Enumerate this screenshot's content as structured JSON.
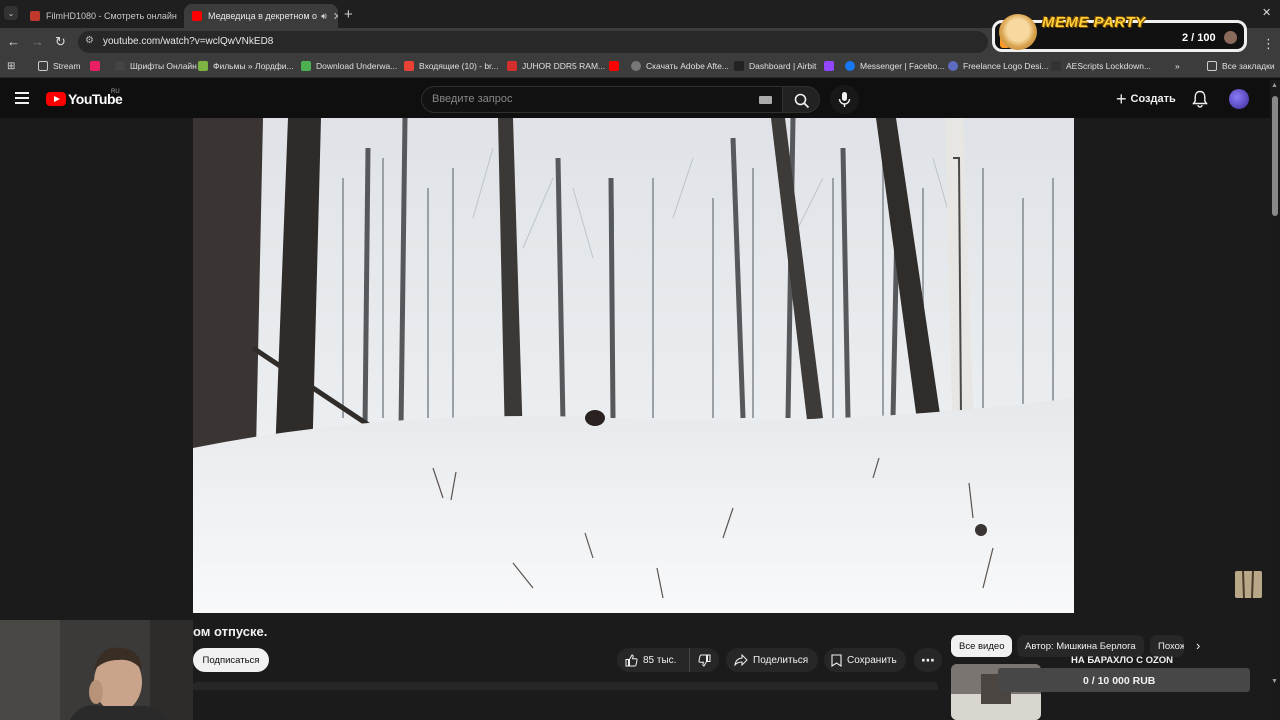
{
  "browser": {
    "tabs": [
      {
        "title": "FilmHD1080 - Смотреть онлайн",
        "active": false
      },
      {
        "title": "Медведица в декретном о",
        "active": true
      }
    ],
    "url": "youtube.com/watch?v=wclQwVNkED8",
    "bookmarks": [
      "Stream",
      "Шрифты Онлайн",
      "Фильмы » Лордфи...",
      "Download Underwa...",
      "Входящие (10) - br...",
      "JUHOR DDR5 RAM...",
      "Скачать Adobe Afte...",
      "Dashboard | Airbit",
      "Messenger | Facebo...",
      "Freelance Logo Desi...",
      "AEScripts Lockdown...",
      "Все закладки"
    ]
  },
  "meme_party": {
    "title": "MEME PARTY",
    "count": "2 / 100"
  },
  "youtube": {
    "logo_text": "YouTube",
    "region": "RU",
    "search_placeholder": "Введите запрос",
    "create_label": "Создать",
    "video_title": "ом отпуске.",
    "subscribe_label": "Подписаться",
    "likes": "85 тыс.",
    "share_label": "Поделиться",
    "save_label": "Сохранить",
    "chips": [
      "Все видео",
      "Автор: Мишкина Берлога",
      "Похож"
    ]
  },
  "donation": {
    "title": "НА БАРАХЛО С OZON",
    "amount": "0 / 10 000 RUB"
  },
  "colors": {
    "brand_red": "#ff0000",
    "page_bg": "#0f0f0f",
    "meme_yellow": "#ffd23a"
  }
}
